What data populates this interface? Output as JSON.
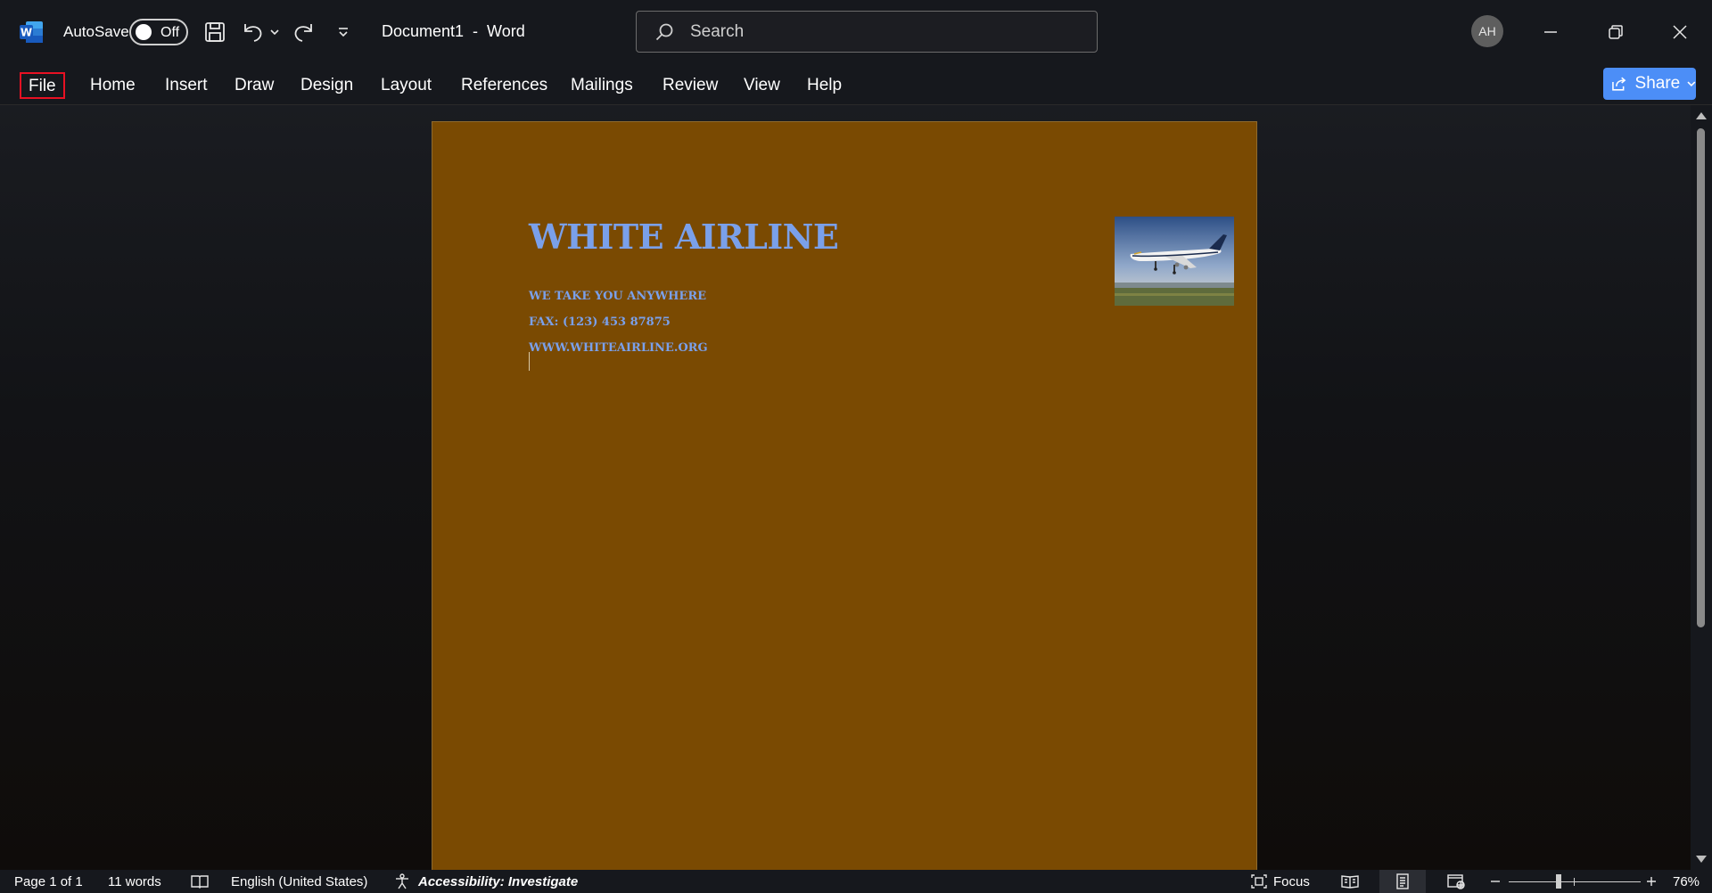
{
  "titlebar": {
    "autosave_label": "AutoSave",
    "autosave_state": "Off",
    "document_title": "Document1  -  Word",
    "search_placeholder": "Search",
    "user_initials": "AH"
  },
  "ribbon": {
    "tabs": [
      "File",
      "Home",
      "Insert",
      "Draw",
      "Design",
      "Layout",
      "References",
      "Mailings",
      "Review",
      "View",
      "Help"
    ],
    "share_label": "Share"
  },
  "document": {
    "heading": "WHITE AIRLINE",
    "lines": [
      "WE TAKE YOU ANYWHERE",
      "FAX: (123) 453 87875",
      "WWW.WHITEAIRLINE.ORG"
    ],
    "page_color": "#7a4a02",
    "text_color": "#7aa0ea"
  },
  "statusbar": {
    "page": "Page 1 of 1",
    "words": "11 words",
    "language": "English (United States)",
    "accessibility": "Accessibility: Investigate",
    "focus": "Focus",
    "zoom": "76%"
  },
  "colors": {
    "chrome": "#16181d",
    "accent": "#4c8ef7",
    "file_highlight": "#e81123"
  }
}
